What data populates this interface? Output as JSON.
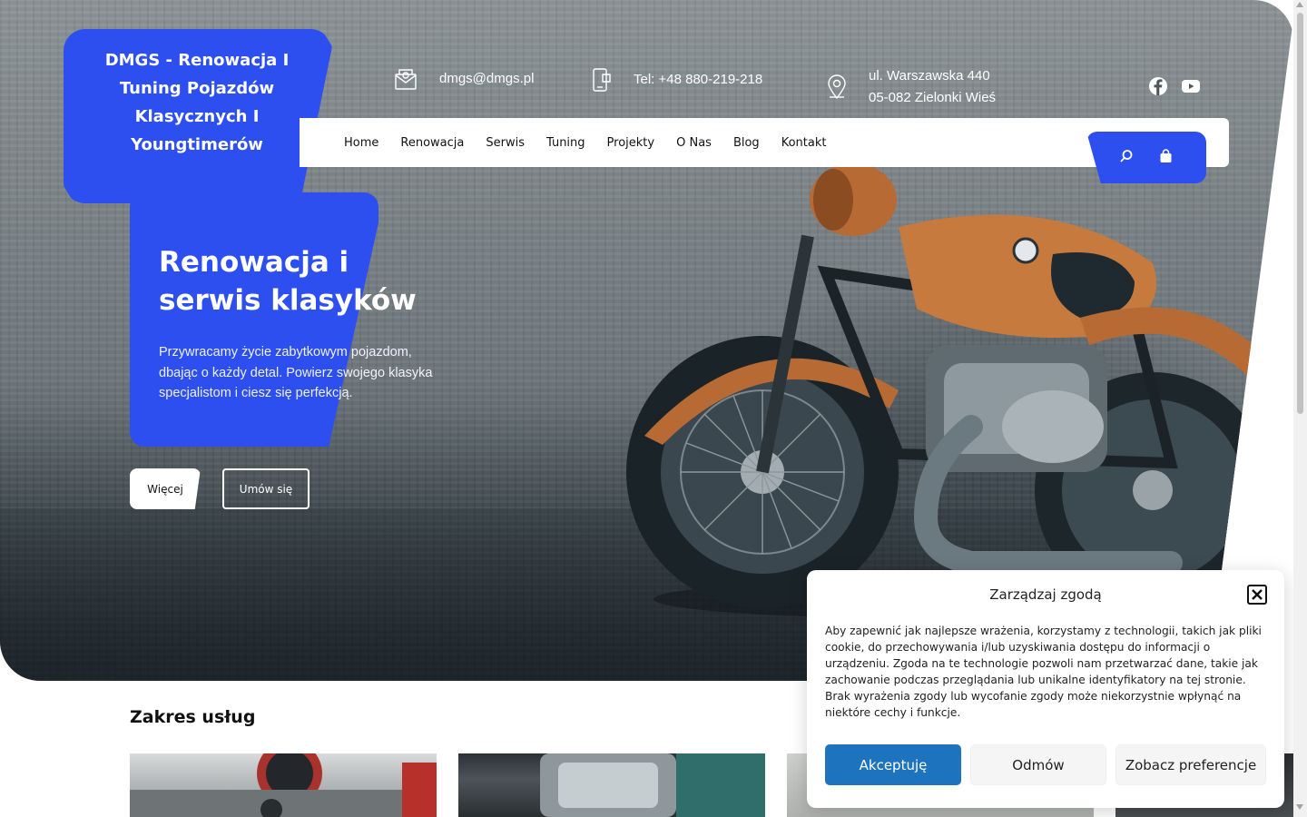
{
  "brand": {
    "logo_text": "DMGS - Renowacja I Tuning Pojazdów Klasycznych I Youngtimerów",
    "accent_color": "#2e4ff0"
  },
  "contact": {
    "email": "dmgs@dmgs.pl",
    "phone": "Tel: +48 880-219-218",
    "address_line1": "ul. Warszawska 440",
    "address_line2": "05-082 Zielonki Wieś",
    "email_icon": "email-icon",
    "phone_icon": "phone-icon",
    "location_icon": "location-pin-icon"
  },
  "social": {
    "facebook_icon": "facebook-icon",
    "youtube_icon": "youtube-icon"
  },
  "nav": {
    "items": [
      {
        "label": "Home"
      },
      {
        "label": "Renowacja"
      },
      {
        "label": "Serwis"
      },
      {
        "label": "Tuning"
      },
      {
        "label": "Projekty"
      },
      {
        "label": "O Nas"
      },
      {
        "label": "Blog"
      },
      {
        "label": "Kontakt"
      }
    ],
    "search_icon": "search-icon",
    "cart_icon": "shopping-bag-icon"
  },
  "hero": {
    "title": "Renowacja i serwis klasyków",
    "desc_line1": "Przywracamy życie zabytkowym pojazdom,",
    "desc_line2": "dbając o każdy detal. Powierz swojego klasyka",
    "desc_line3": "specjalistom i ciesz się perfekcją.",
    "btn_more": "Więcej",
    "btn_book": "Umów się"
  },
  "services": {
    "title": "Zakres usług"
  },
  "cookie": {
    "title": "Zarządzaj zgodą",
    "text": "Aby zapewnić jak najlepsze wrażenia, korzystamy z technologii, takich jak pliki cookie, do przechowywania i/lub uzyskiwania dostępu do informacji o urządzeniu. Zgoda na te technologie pozwoli nam przetwarzać dane, takie jak zachowanie podczas przeglądania lub unikalne identyfikatory na tej stronie. Brak wyrażenia zgody lub wycofanie zgody może niekorzystnie wpłynąć na niektóre cechy i funkcje.",
    "accept": "Akceptuję",
    "deny": "Odmów",
    "preferences": "Zobacz preferencje",
    "accept_color": "#1e73be"
  }
}
